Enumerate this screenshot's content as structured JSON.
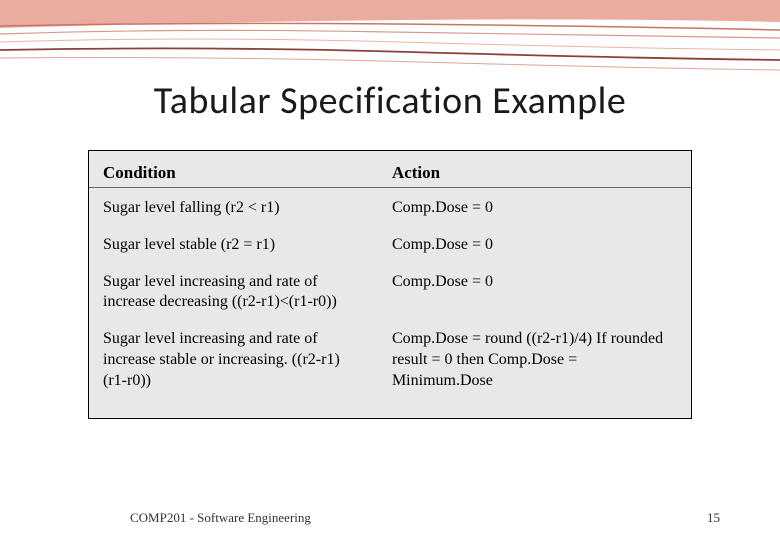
{
  "slide": {
    "title": "Tabular Specification Example",
    "footer_text": "COMP201 - Software Engineering",
    "page_number": "15"
  },
  "table": {
    "headers": {
      "col1": "Condition",
      "col2": "Action"
    },
    "rows": [
      {
        "condition": "Sugar level falling (r2 < r1)",
        "action": "Comp.Dose = 0"
      },
      {
        "condition": "Sugar level stable (r2 = r1)",
        "action": "Comp.Dose = 0"
      },
      {
        "condition": "Sugar level increasing and rate of increase decreasing ((r2-r1)<(r1-r0))",
        "action": "Comp.Dose = 0"
      },
      {
        "condition": "Sugar level increasing and rate of increase stable or increasing. ((r2-r1) (r1-r0))",
        "action": "Comp.Dose = round ((r2-r1)/4) If rounded result = 0 then Comp.Dose = Minimum.Dose"
      }
    ]
  }
}
